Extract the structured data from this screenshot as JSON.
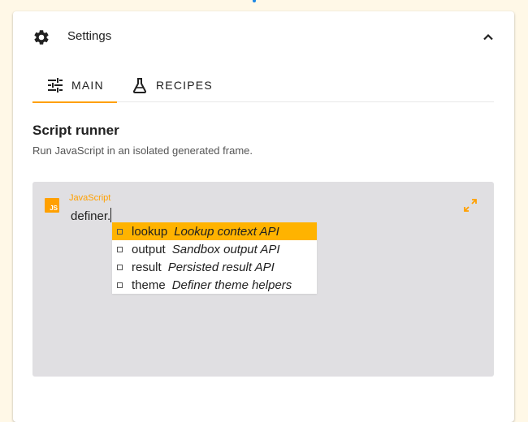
{
  "header": {
    "title": "Settings"
  },
  "tabs": [
    {
      "label": "MAIN",
      "icon": "sliders-icon",
      "active": true
    },
    {
      "label": "RECIPES",
      "icon": "flask-icon",
      "active": false
    }
  ],
  "section": {
    "title": "Script runner",
    "description": "Run JavaScript in an isolated generated frame."
  },
  "editor": {
    "language": "JavaScript",
    "badge": "JS",
    "code": "definer."
  },
  "suggestions": [
    {
      "name": "lookup",
      "description": "Lookup context API",
      "selected": true
    },
    {
      "name": "output",
      "description": "Sandbox output API",
      "selected": false
    },
    {
      "name": "result",
      "description": "Persisted result API",
      "selected": false
    },
    {
      "name": "theme",
      "description": "Definer theme helpers",
      "selected": false
    }
  ],
  "colors": {
    "accent": "#ffa000",
    "selection": "#ffb300",
    "editor_bg": "#e0dfe2",
    "page_bg": "#fff8e7"
  }
}
